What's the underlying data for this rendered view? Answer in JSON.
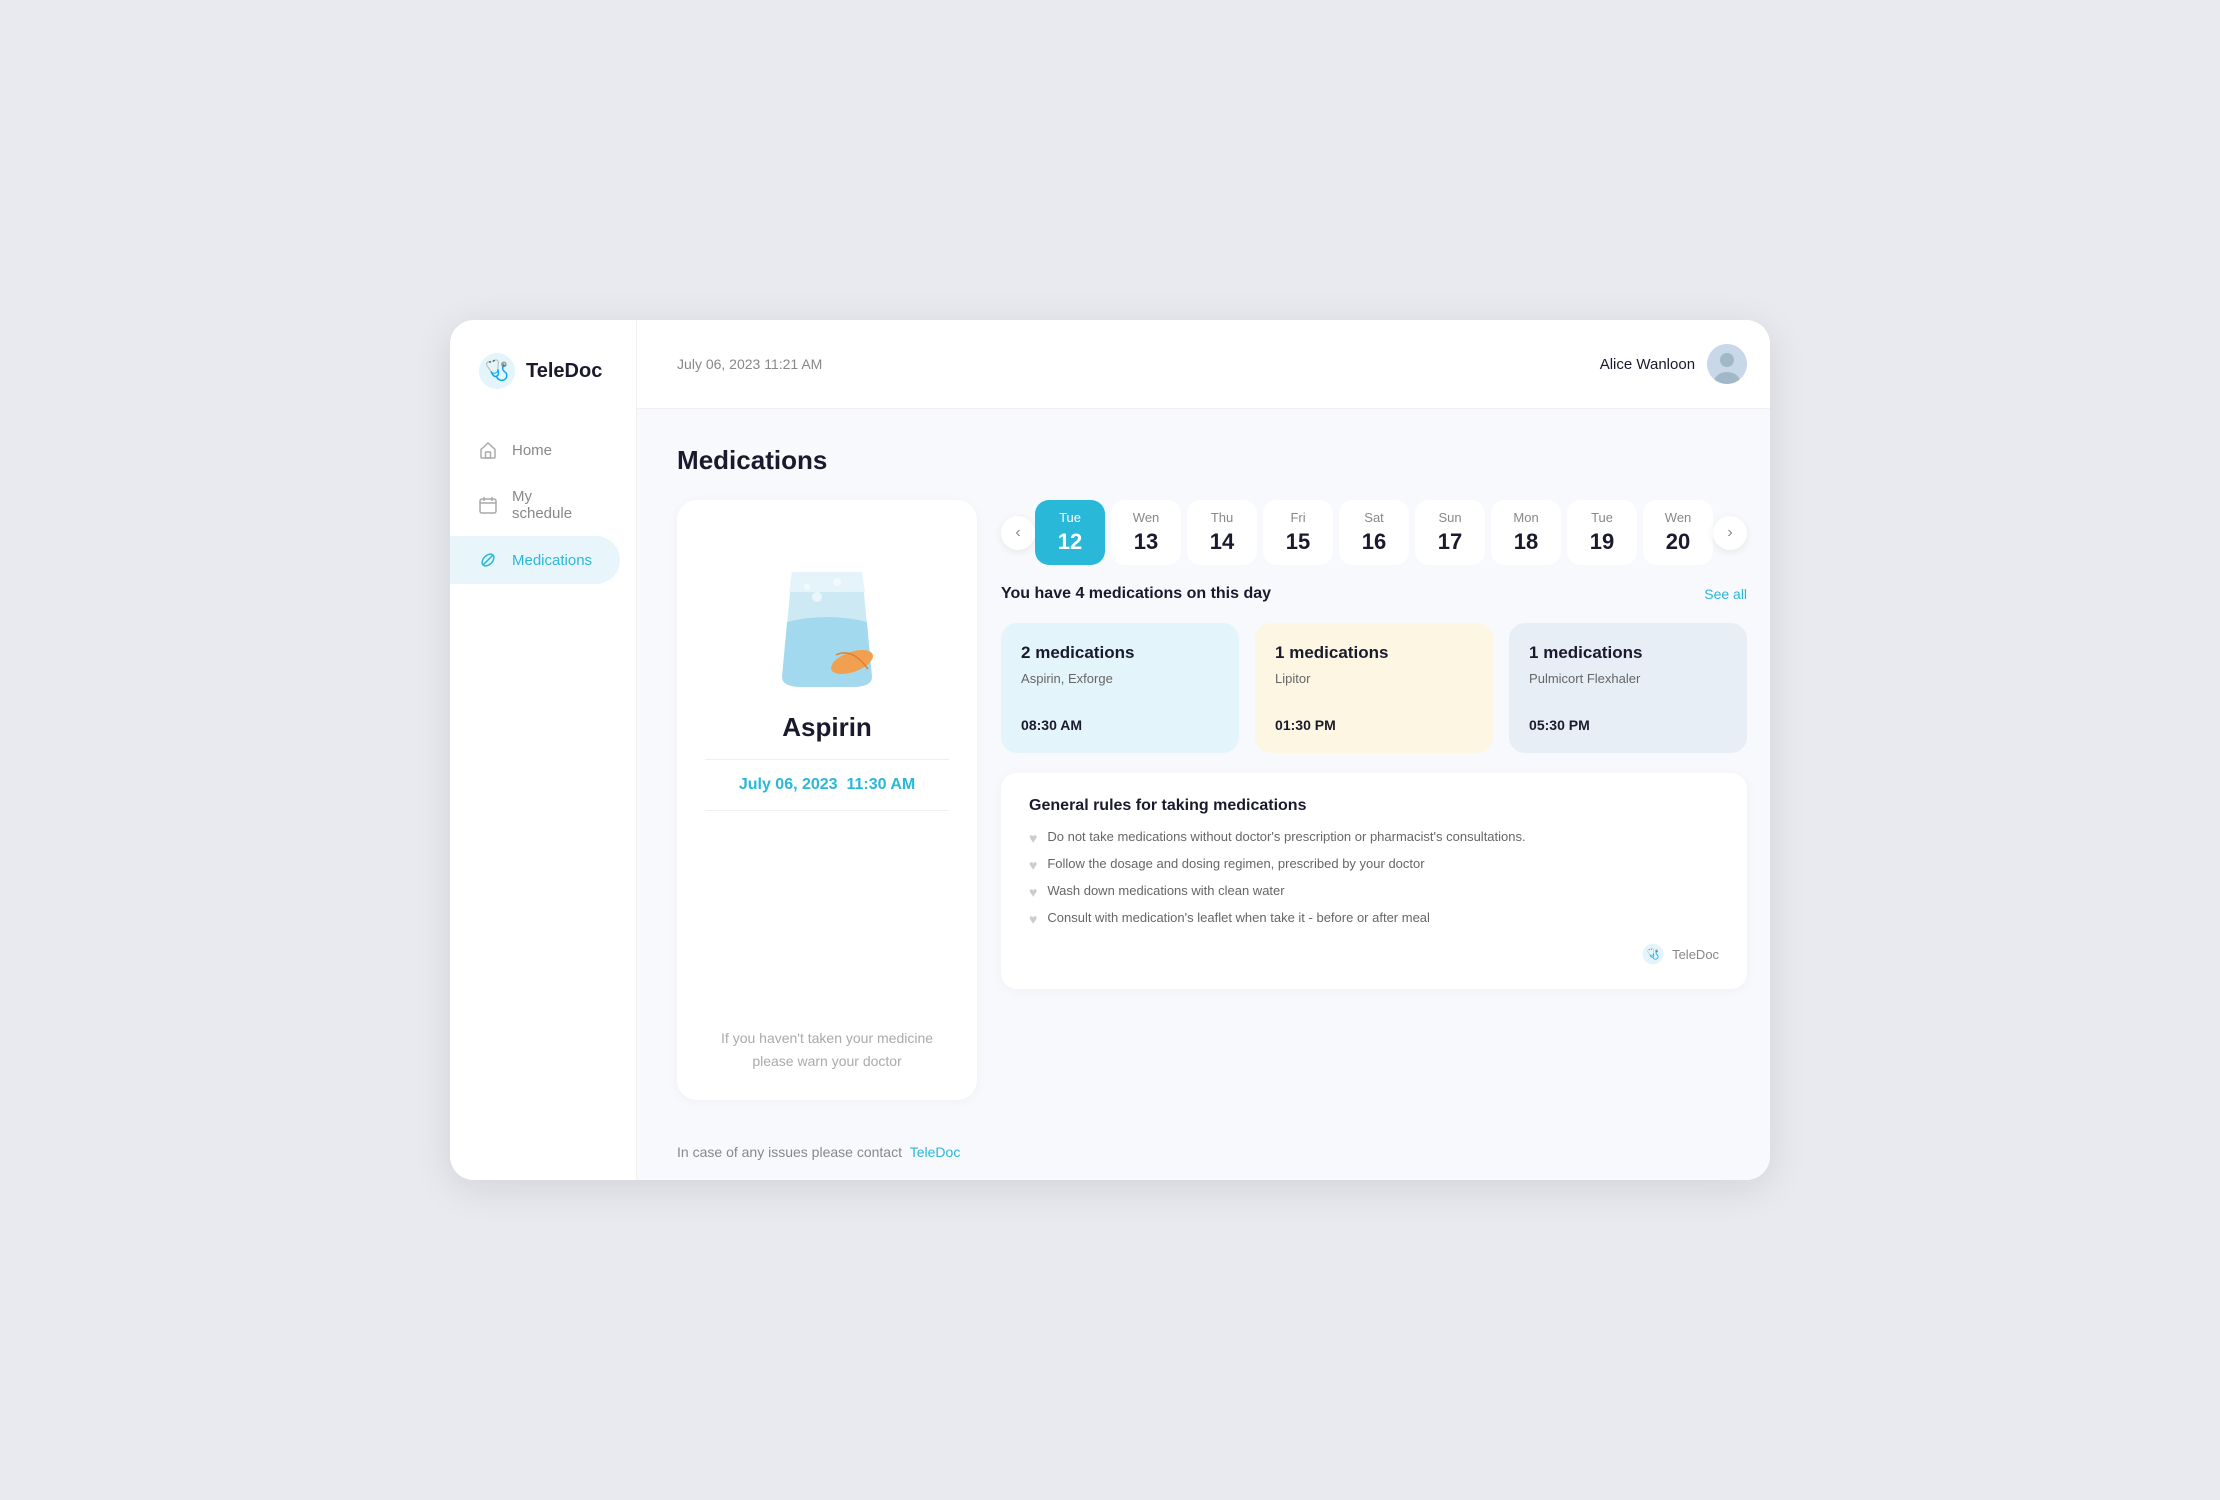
{
  "app": {
    "name": "TeleDoc"
  },
  "header": {
    "datetime": "July 06, 2023 11:21 AM",
    "username": "Alice Wanloon"
  },
  "sidebar": {
    "items": [
      {
        "id": "home",
        "label": "Home",
        "icon": "home-icon",
        "active": false
      },
      {
        "id": "my-schedule",
        "label": "My schedule",
        "icon": "calendar-icon",
        "active": false
      },
      {
        "id": "medications",
        "label": "Medications",
        "icon": "pill-icon",
        "active": true
      }
    ]
  },
  "page": {
    "title": "Medications"
  },
  "med_card": {
    "name": "Aspirin",
    "date": "July 06, 2023",
    "time": "11:30 AM",
    "note": "If you haven't taken your medicine please warn your doctor"
  },
  "calendar": {
    "prev_label": "‹",
    "next_label": "›",
    "days": [
      {
        "name": "Tue",
        "num": "12",
        "active": true
      },
      {
        "name": "Wen",
        "num": "13",
        "active": false
      },
      {
        "name": "Thu",
        "num": "14",
        "active": false
      },
      {
        "name": "Fri",
        "num": "15",
        "active": false
      },
      {
        "name": "Sat",
        "num": "16",
        "active": false
      },
      {
        "name": "Sun",
        "num": "17",
        "active": false
      },
      {
        "name": "Mon",
        "num": "18",
        "active": false
      },
      {
        "name": "Tue",
        "num": "19",
        "active": false
      },
      {
        "name": "Wen",
        "num": "20",
        "active": false
      }
    ]
  },
  "medications_summary": {
    "title": "You have 4 medications on this day",
    "see_all": "See all",
    "cards": [
      {
        "count": "2 medications",
        "meds": "Aspirin, Exforge",
        "time": "08:30 AM",
        "style": "blue"
      },
      {
        "count": "1 medications",
        "meds": "Lipitor",
        "time": "01:30 PM",
        "style": "yellow"
      },
      {
        "count": "1 medications",
        "meds": "Pulmicort Flexhaler",
        "time": "05:30 PM",
        "style": "light-blue"
      }
    ]
  },
  "rules": {
    "title": "General rules for taking medications",
    "items": [
      "Do not take medications without doctor's prescription or pharmacist's consultations.",
      "Follow the dosage and dosing regimen, prescribed by your doctor",
      "Wash down medications with clean water",
      "Consult with medication's leaflet when take it - before or after meal"
    ],
    "footer_brand": "TeleDoc"
  },
  "footer": {
    "text": "In case of any issues please contact",
    "link_label": "TeleDoc"
  }
}
